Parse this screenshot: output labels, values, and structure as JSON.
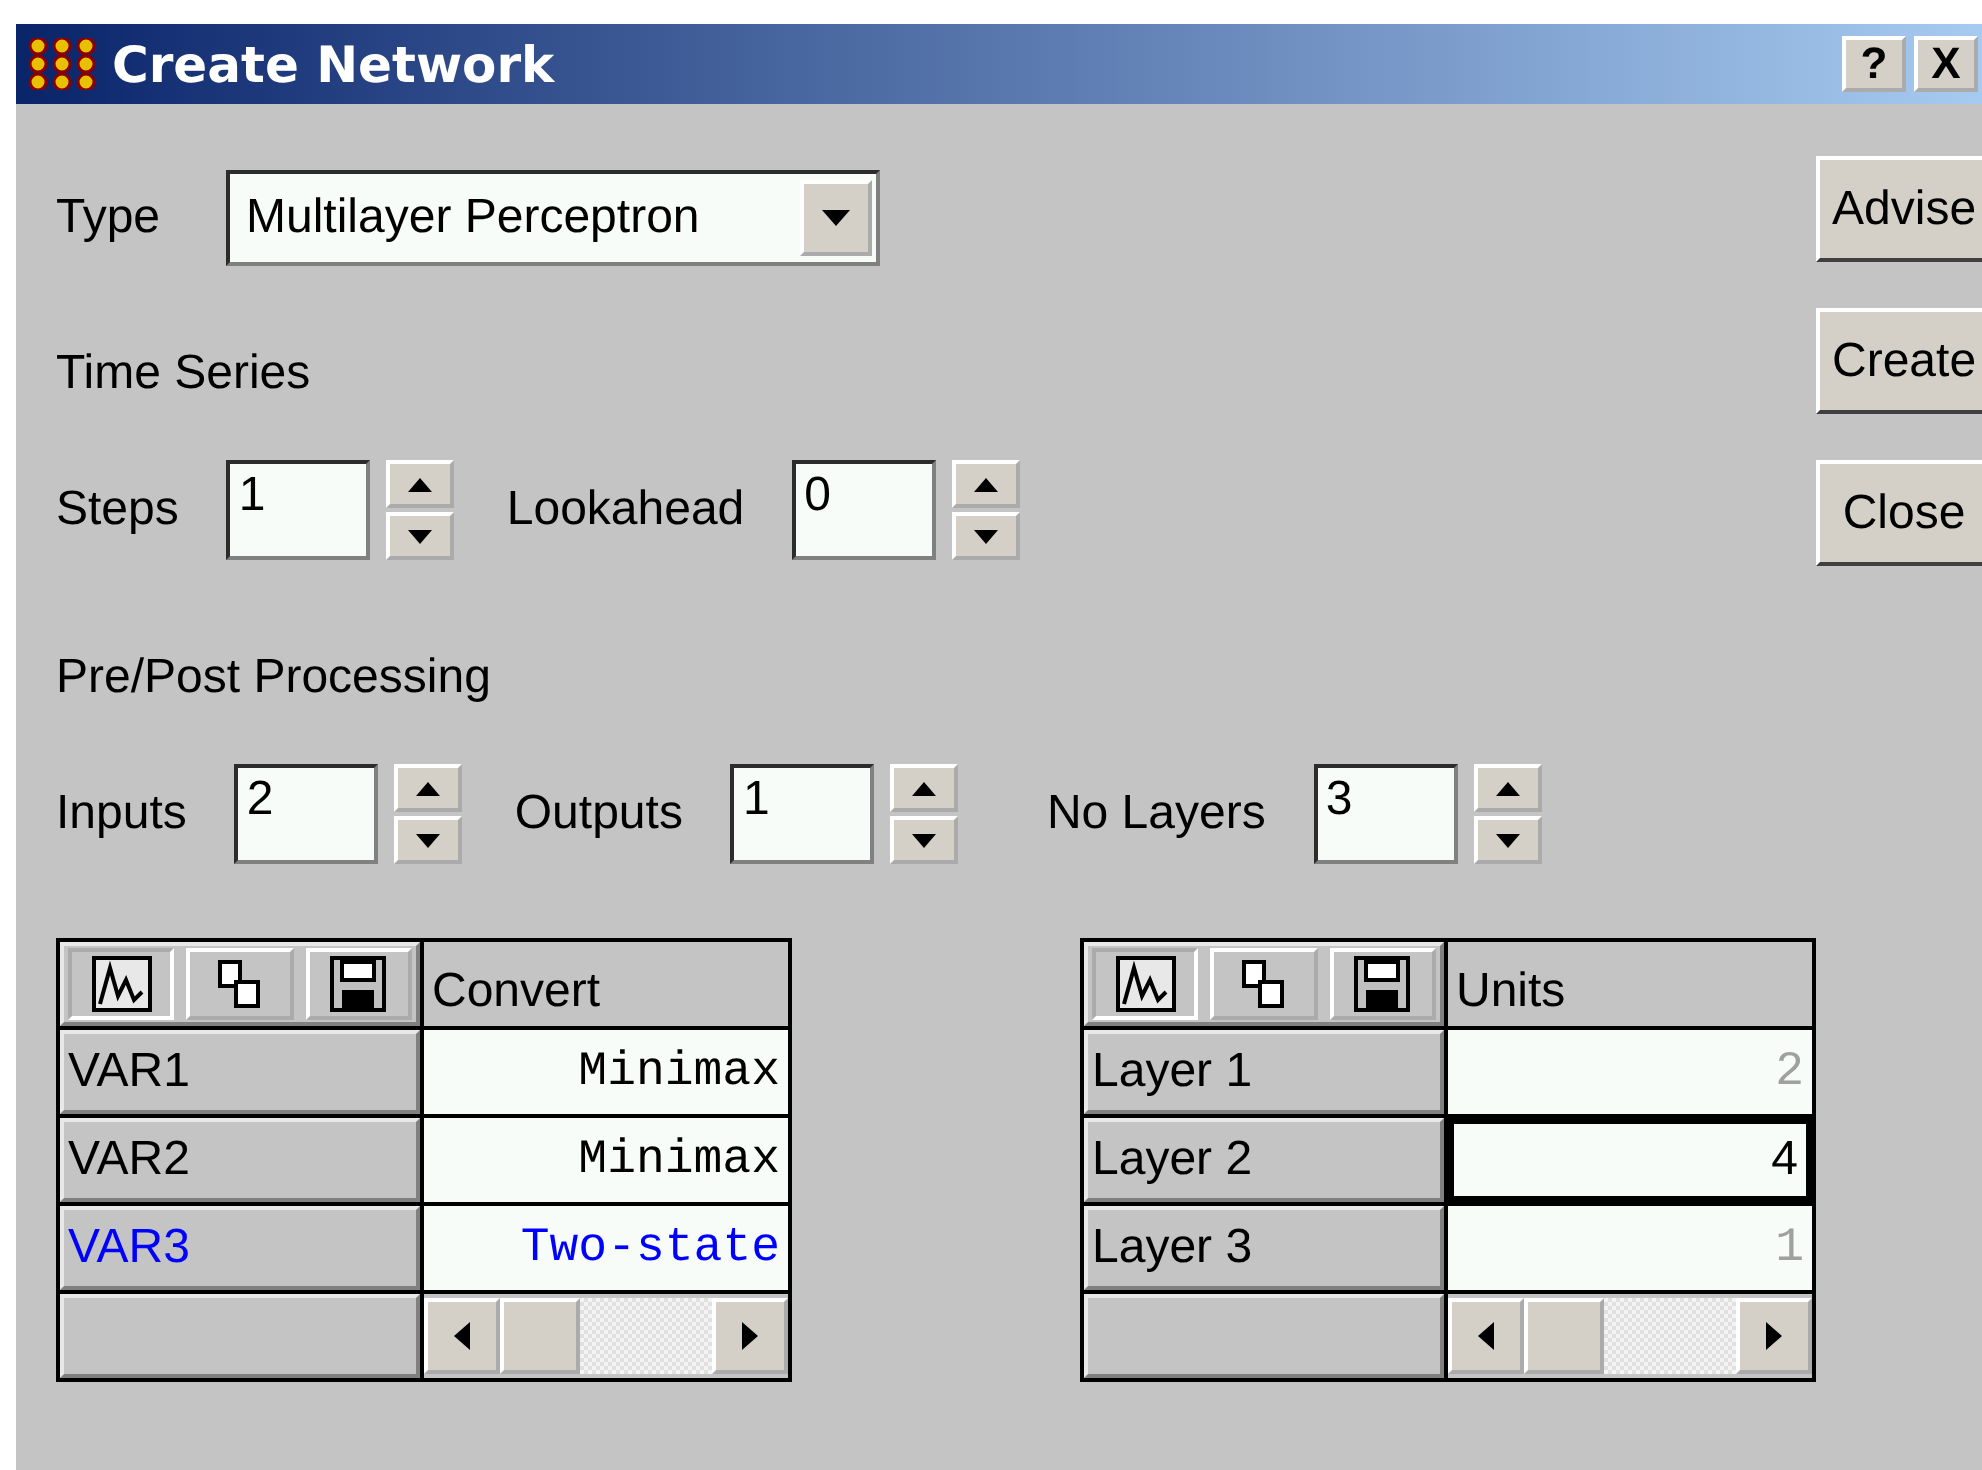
{
  "window": {
    "title": "Create Network",
    "help_button": "?",
    "close_button": "X"
  },
  "type": {
    "label": "Type",
    "value": "Multilayer Perceptron"
  },
  "time_series": {
    "title": "Time Series",
    "fields": [
      {
        "label": "Steps",
        "value": "1"
      },
      {
        "label": "Lookahead",
        "value": "0"
      }
    ]
  },
  "processing": {
    "title": "Pre/Post Processing",
    "fields": [
      {
        "label": "Inputs",
        "value": "2"
      },
      {
        "label": "Outputs",
        "value": "1"
      },
      {
        "label": "No Layers",
        "value": "3"
      }
    ]
  },
  "variables_grid": {
    "header": "Convert",
    "rows": [
      {
        "name": "VAR1",
        "value": "Minimax",
        "color": "#000000"
      },
      {
        "name": "VAR2",
        "value": "Minimax",
        "color": "#000000"
      },
      {
        "name": "VAR3",
        "value": "Two-state",
        "color": "#0000ff"
      }
    ]
  },
  "layers_grid": {
    "header": "Units",
    "rows": [
      {
        "name": "Layer 1",
        "value": "2",
        "selected": false,
        "disabled": true
      },
      {
        "name": "Layer 2",
        "value": "4",
        "selected": true,
        "disabled": false
      },
      {
        "name": "Layer 3",
        "value": "1",
        "selected": false,
        "disabled": true
      }
    ]
  },
  "buttons": [
    "Advise",
    "Create",
    "Close"
  ]
}
